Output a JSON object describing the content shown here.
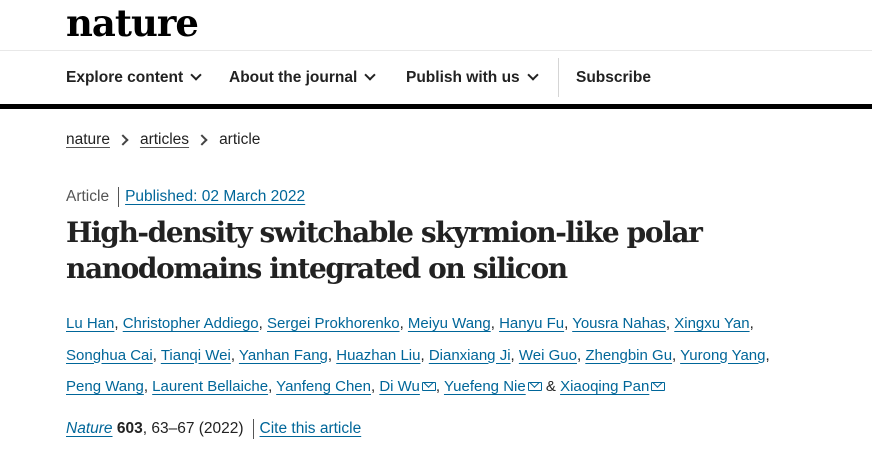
{
  "site": {
    "logo": "nature"
  },
  "nav": {
    "items": [
      {
        "label": "Explore content"
      },
      {
        "label": "About the journal"
      },
      {
        "label": "Publish with us"
      }
    ],
    "subscribe": "Subscribe"
  },
  "breadcrumb": [
    "nature",
    "articles",
    "article"
  ],
  "article": {
    "type": "Article",
    "published": "Published: 02 March 2022",
    "title": "High-density switchable skyrmion-like polar nanodomains integrated on silicon",
    "authors": [
      "Lu Han",
      "Christopher Addiego",
      "Sergei Prokhorenko",
      "Meiyu Wang",
      "Hanyu Fu",
      "Yousra Nahas",
      "Xingxu Yan",
      "Songhua Cai",
      "Tianqi Wei",
      "Yanhan Fang",
      "Huazhan Liu",
      "Dianxiang Ji",
      "Wei Guo",
      "Zhengbin Gu",
      "Yurong Yang",
      "Peng Wang",
      "Laurent Bellaiche",
      "Yanfeng Chen",
      "Di Wu",
      "Yuefeng Nie",
      "Xiaoqing Pan"
    ],
    "corresponding_icon": "mail-icon",
    "ampersand": "&",
    "journal": "Nature",
    "volume": "603",
    "pages": ", 63–67 (2022)",
    "cite_label": "Cite this article"
  },
  "colors": {
    "link": "#006699",
    "text": "#222222",
    "nav_border": "#000000"
  }
}
